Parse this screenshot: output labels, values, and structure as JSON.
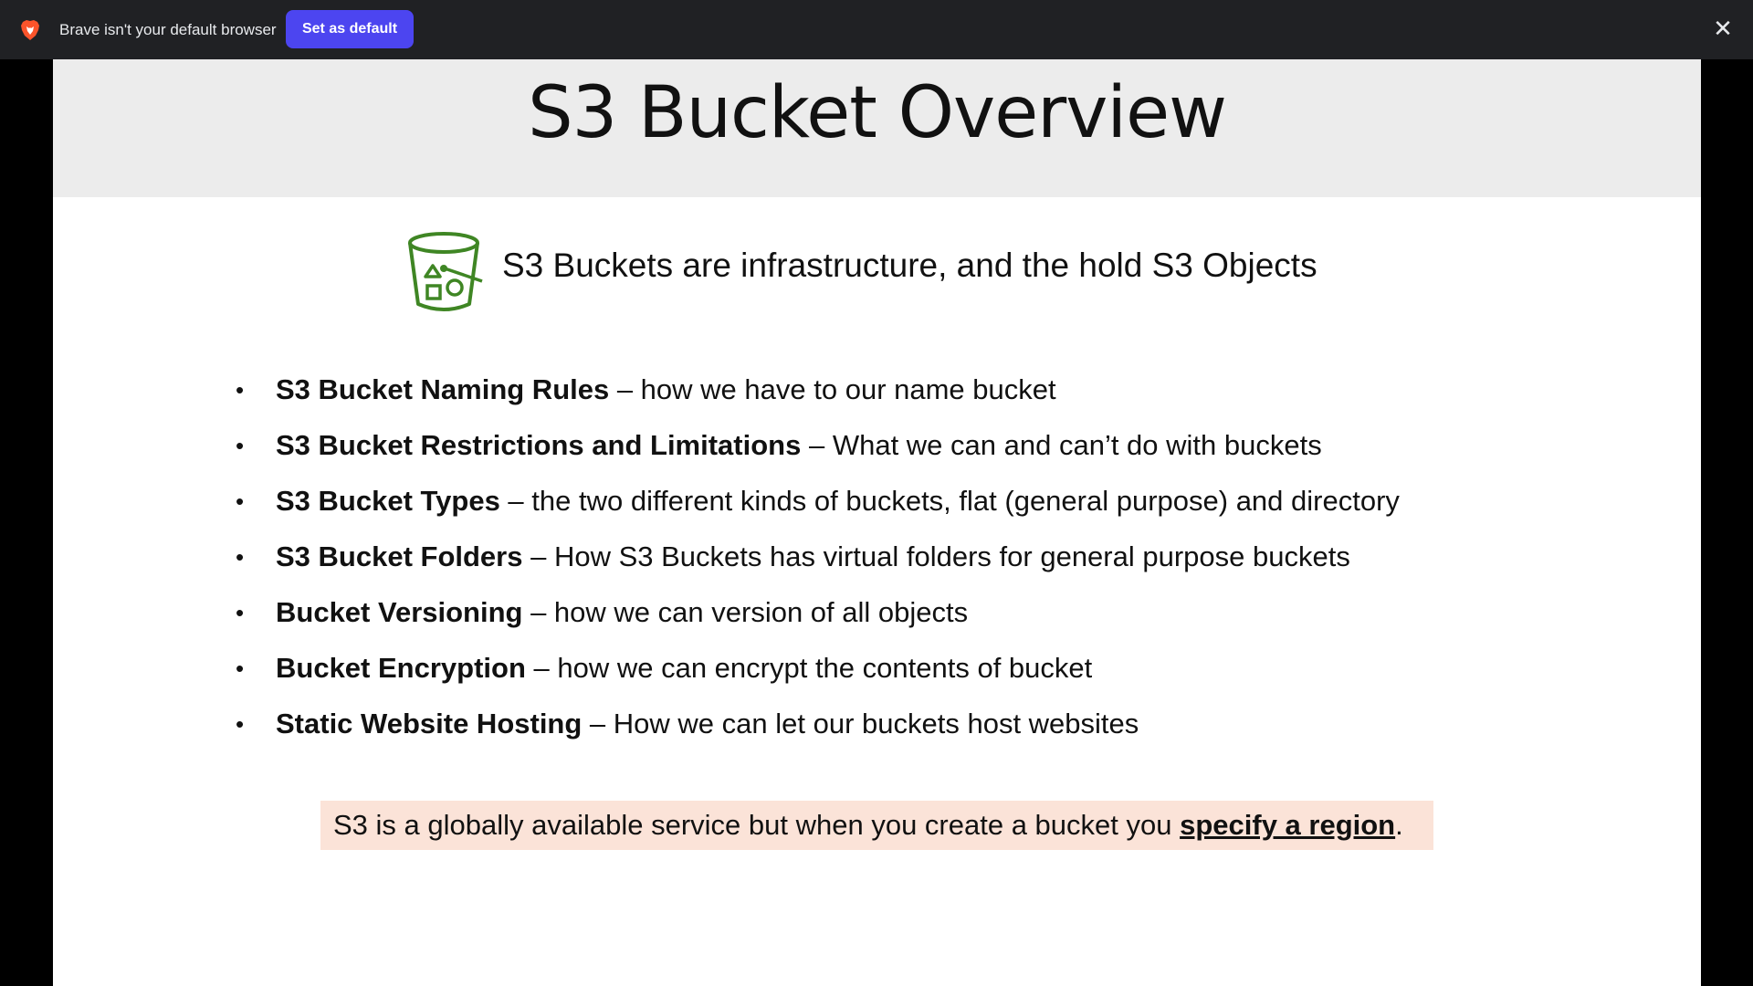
{
  "infobar": {
    "message": "Brave isn't your default browser",
    "set_default_label": "Set as default",
    "close_glyph": "✕",
    "accent": "#4c45f0",
    "background": "#202124"
  },
  "slide": {
    "title": "S3 Bucket Overview",
    "subtitle": "S3 Buckets are infrastructure, and the hold S3 Objects",
    "icon": "s3-bucket-icon",
    "icon_color": "#3f8624",
    "bullets": [
      {
        "bold": "S3 Bucket Naming Rules",
        "rest": " – how we have to our name bucket"
      },
      {
        "bold": "S3 Bucket Restrictions and Limitations",
        "rest": " – What we can and can’t do with buckets"
      },
      {
        "bold": "S3 Bucket Types",
        "rest": " – the two different kinds of buckets, flat (general purpose) and directory"
      },
      {
        "bold": "S3 Bucket Folders",
        "rest": " – How S3 Buckets has virtual folders for general purpose buckets"
      },
      {
        "bold": "Bucket Versioning",
        "rest": " – how we can version of all objects"
      },
      {
        "bold": "Bucket Encryption",
        "rest": " – how we can encrypt the contents of bucket"
      },
      {
        "bold": "Static Website Hosting",
        "rest": " – How we can let our buckets host websites"
      }
    ],
    "bullet_glyph": "•",
    "note": {
      "before": "S3 is a globally available service but when you create a bucket you ",
      "emphasis": "specify a region",
      "after": ".",
      "background": "#fbe3d8"
    }
  }
}
